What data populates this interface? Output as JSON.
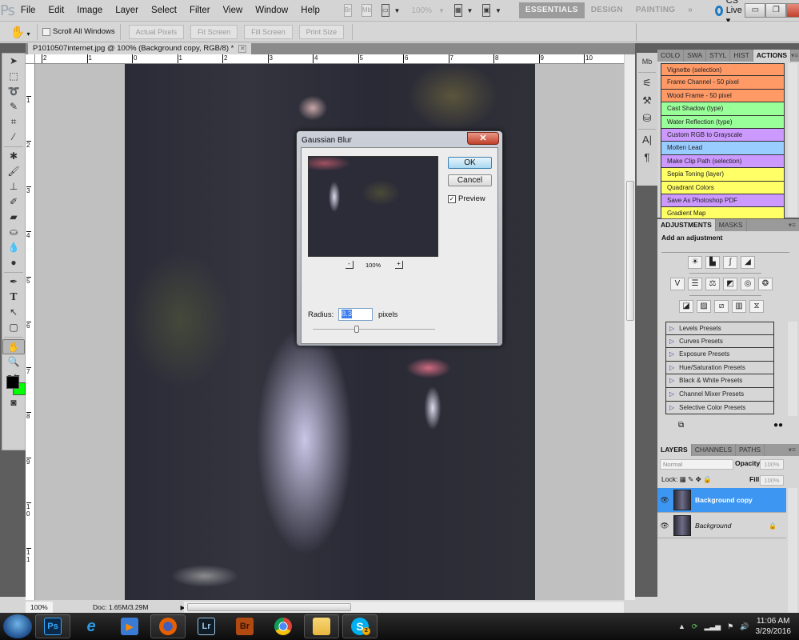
{
  "app": {
    "logo": "Ps"
  },
  "menu": {
    "items": [
      "File",
      "Edit",
      "Image",
      "Layer",
      "Select",
      "Filter",
      "View",
      "Window",
      "Help"
    ],
    "zoom_select": "100%",
    "workspaces": [
      {
        "label": "ESSENTIALS",
        "active": true
      },
      {
        "label": "DESIGN",
        "active": false
      },
      {
        "label": "PAINTING",
        "active": false
      }
    ],
    "more": "»",
    "cs_live": "CS Live ▾"
  },
  "options": {
    "scroll_all_label": "Scroll All Windows",
    "scroll_all_checked": false,
    "buttons": [
      "Actual Pixels",
      "Fit Screen",
      "Fill Screen",
      "Print Size"
    ]
  },
  "document": {
    "tab_title": "P1010507internet.jpg @ 100% (Background copy, RGB/8) *",
    "ruler_h": [
      "2",
      "1",
      "0",
      "1",
      "2",
      "3",
      "4",
      "5",
      "6",
      "7",
      "8",
      "9",
      "10",
      "1"
    ],
    "ruler_v": [
      "1",
      "2",
      "3",
      "4",
      "5",
      "6",
      "7",
      "8",
      "9",
      "10",
      "11"
    ]
  },
  "status": {
    "zoom": "100%",
    "doc": "Doc: 1.65M/3.29M"
  },
  "tools": [
    "move-tool",
    "marquee-tool",
    "lasso-tool",
    "quick-selection-tool",
    "crop-tool",
    "eyedropper-tool",
    "spot-healing-tool",
    "brush-tool",
    "clone-stamp-tool",
    "history-brush-tool",
    "eraser-tool",
    "paint-bucket-tool",
    "blur-tool",
    "dodge-tool",
    "pen-tool",
    "type-tool",
    "path-selection-tool",
    "shape-tool",
    "hand-tool",
    "zoom-tool"
  ],
  "colors": {
    "foreground": "#000000",
    "background": "#00ff00",
    "accent": "#3d97f2"
  },
  "actions_panel": {
    "tabs": [
      "COLO",
      "SWA",
      "STYL",
      "HIST",
      "ACTIONS"
    ],
    "active_tab": "ACTIONS",
    "items": [
      {
        "label": "Vignette (selection)",
        "color": "#ff9966"
      },
      {
        "label": "Frame Channel - 50 pixel",
        "color": "#ff9966"
      },
      {
        "label": "Wood Frame - 50 pixel",
        "color": "#ff9966"
      },
      {
        "label": "Cast Shadow (type)",
        "color": "#99ff99"
      },
      {
        "label": "Water Reflection (type)",
        "color": "#99ff99"
      },
      {
        "label": "Custom RGB to Grayscale",
        "color": "#cc99ff"
      },
      {
        "label": "Molten Lead",
        "color": "#99ccff"
      },
      {
        "label": "Make Clip Path (selection)",
        "color": "#cc99ff"
      },
      {
        "label": "Sepia Toning (layer)",
        "color": "#ffff66"
      },
      {
        "label": "Quadrant Colors",
        "color": "#ffff66"
      },
      {
        "label": "Save As Photoshop PDF",
        "color": "#cc99ff"
      },
      {
        "label": "Gradient Map",
        "color": "#ffff66"
      }
    ]
  },
  "adjustments_panel": {
    "tabs": [
      "ADJUSTMENTS",
      "MASKS"
    ],
    "title": "Add an adjustment",
    "row1": [
      "brightness-contrast",
      "levels",
      "curves",
      "exposure"
    ],
    "row2": [
      "vibrance",
      "hue-saturation",
      "color-balance",
      "black-white",
      "photo-filter",
      "channel-mixer"
    ],
    "row3": [
      "invert",
      "posterize",
      "threshold",
      "gradient-map",
      "selective-color"
    ],
    "presets": [
      "Levels Presets",
      "Curves Presets",
      "Exposure Presets",
      "Hue/Saturation Presets",
      "Black & White Presets",
      "Channel Mixer Presets",
      "Selective Color Presets"
    ]
  },
  "layers_panel": {
    "tabs": [
      "LAYERS",
      "CHANNELS",
      "PATHS"
    ],
    "blend_mode": "Normal",
    "opacity_label": "Opacity:",
    "opacity": "100%",
    "lock_label": "Lock:",
    "fill_label": "Fill:",
    "fill": "100%",
    "layers": [
      {
        "name": "Background copy",
        "selected": true,
        "visible": true,
        "locked": false
      },
      {
        "name": "Background",
        "selected": false,
        "visible": true,
        "locked": true
      }
    ]
  },
  "dialog": {
    "title": "Gaussian Blur",
    "ok": "OK",
    "cancel": "Cancel",
    "preview_label": "Preview",
    "preview_checked": true,
    "zoom": "100%",
    "radius_label": "Radius:",
    "radius": "8.3",
    "units": "pixels",
    "slider_fraction": 0.36
  },
  "taskbar": {
    "apps": [
      "Photoshop",
      "Internet Explorer",
      "Media Player",
      "Firefox",
      "Lightroom",
      "Bridge",
      "Chrome",
      "File Explorer",
      "Skype"
    ],
    "skype_badge": "2",
    "time": "11:06 AM",
    "date": "3/29/2016"
  }
}
